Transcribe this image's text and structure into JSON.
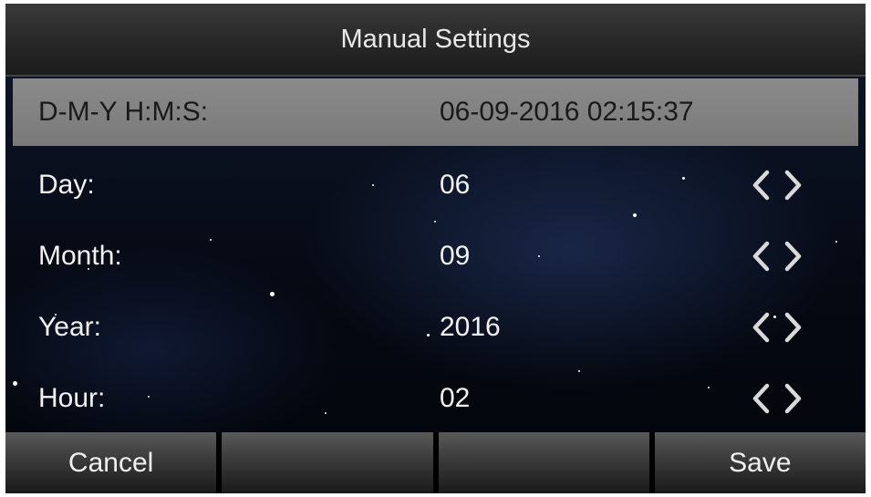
{
  "title": "Manual Settings",
  "summary": {
    "label": "D-M-Y H:M:S:",
    "value": "06-09-2016 02:15:37"
  },
  "fields": [
    {
      "label": "Day:",
      "value": "06"
    },
    {
      "label": "Month:",
      "value": "09"
    },
    {
      "label": "Year:",
      "value": "2016"
    },
    {
      "label": "Hour:",
      "value": "02"
    }
  ],
  "softkeys": [
    "Cancel",
    "",
    "",
    "Save"
  ],
  "icons": {
    "decrease": "chevron-left-icon",
    "increase": "chevron-right-icon"
  },
  "colors": {
    "summary_bg": "#808080",
    "text": "#f2f2f2",
    "arrow": "#d9d9d9"
  }
}
